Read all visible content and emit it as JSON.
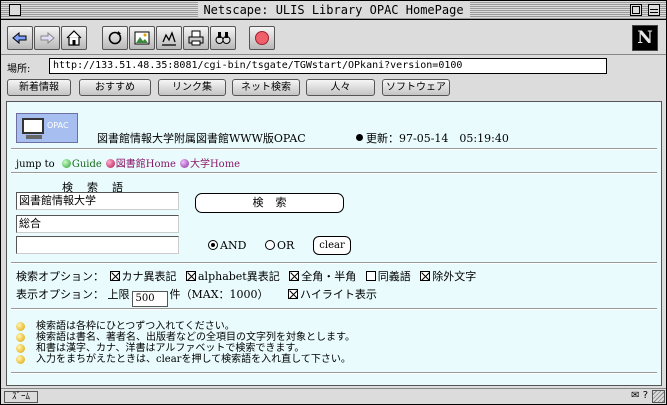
{
  "window": {
    "title": "Netscape: ULIS Library OPAC HomePage"
  },
  "toolbar": {
    "buttons": [
      {
        "name": "back-icon"
      },
      {
        "name": "forward-icon"
      },
      {
        "name": "home-icon"
      },
      {
        "name": "reload-icon"
      },
      {
        "name": "images-icon"
      },
      {
        "name": "open-icon"
      },
      {
        "name": "print-icon"
      },
      {
        "name": "find-icon"
      },
      {
        "name": "stop-icon"
      }
    ],
    "logo_letter": "N"
  },
  "location": {
    "label": "場所:",
    "url": "http://133.51.48.35:8081/cgi-bin/tsgate/TGWstart/OPkani?version=0100"
  },
  "directory": {
    "buttons": [
      "新着情報",
      "おすすめ",
      "リンク集",
      "ネット検索",
      "人々",
      "ソフトウェア"
    ]
  },
  "page": {
    "logo_text": "OPAC",
    "title": "図書館情報大学附属図書館WWW版OPAC",
    "update_label": "更新：97-05-14　05:19:40",
    "jump_label": "jump to",
    "jump_links": [
      {
        "label": "Guide",
        "color": "#2a9a2a"
      },
      {
        "label": "図書館Home",
        "color": "#b0104a"
      },
      {
        "label": "大学Home",
        "color": "#8a2a9a"
      }
    ],
    "search_heading": "検索語",
    "search_fields": [
      "図書館情報大学",
      "総合",
      ""
    ],
    "search_button": "検索",
    "radio_and": "AND",
    "radio_or": "OR",
    "radio_selected": "AND",
    "clear_button": "clear",
    "search_options_label": "検索オプション：",
    "search_options": [
      {
        "label": "カナ異表記",
        "checked": true
      },
      {
        "label": "alphabet異表記",
        "checked": true
      },
      {
        "label": "全角・半角",
        "checked": true
      },
      {
        "label": "同義語",
        "checked": false
      },
      {
        "label": "除外文字",
        "checked": true
      }
    ],
    "display_options_label": "表示オプション：",
    "limit_label": "上限",
    "limit_value": "500",
    "limit_unit": "件（MAX：1000）",
    "highlight_label": "ハイライト表示",
    "highlight_checked": true,
    "notes": [
      "検索語は各枠にひとつずつ入れてください。",
      "検索語は書名、著者名、出版者などの全項目の文字列を対象とします。",
      "和書は漢字、カナ、洋書はアルファベットで検索できます。",
      "入力をまちがえたときは、clearを押して検索語を入れ直して下さい。"
    ]
  },
  "statusbar": {
    "left": "ｽﾞｰﾑ"
  }
}
